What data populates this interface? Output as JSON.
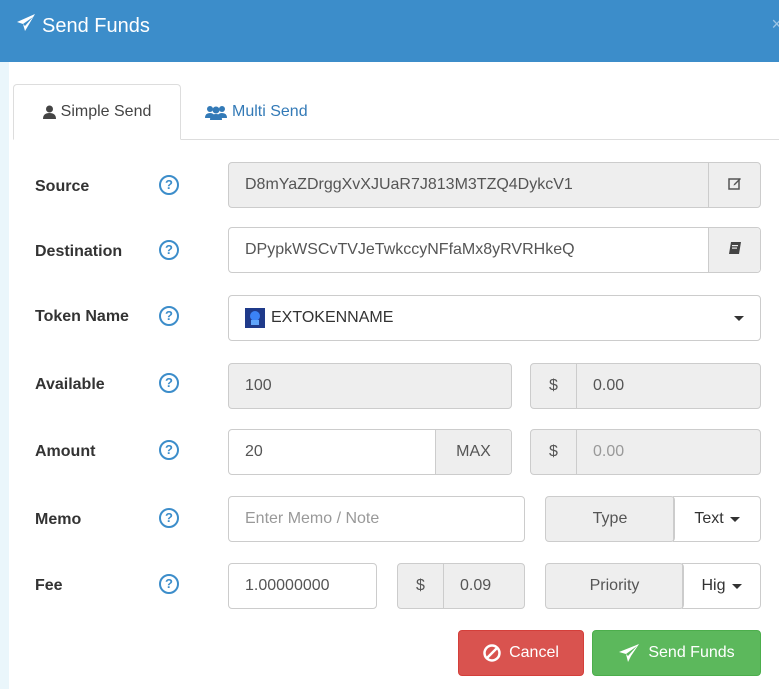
{
  "header": {
    "title": "Send Funds",
    "close": "×"
  },
  "tabs": [
    {
      "label": "Simple Send",
      "active": true
    },
    {
      "label": "Multi Send",
      "active": false
    }
  ],
  "form": {
    "source": {
      "label": "Source",
      "value": "D8mYaZDrggXvXJUaR7J813M3TZQ4DykcV1"
    },
    "destination": {
      "label": "Destination",
      "value": "DPypkWSCvTVJeTwkccyNFfaMx8yRVRHkeQ"
    },
    "token": {
      "label": "Token Name",
      "value": "EXTOKENNAME"
    },
    "available": {
      "label": "Available",
      "value": "100",
      "currency": "$",
      "usd": "0.00"
    },
    "amount": {
      "label": "Amount",
      "value": "20",
      "max": "MAX",
      "currency": "$",
      "usd": "0.00"
    },
    "memo": {
      "label": "Memo",
      "placeholder": "Enter Memo / Note",
      "type_label": "Type",
      "type_value": "Text"
    },
    "fee": {
      "label": "Fee",
      "value": "1.00000000",
      "currency": "$",
      "usd": "0.09",
      "priority_label": "Priority",
      "priority_value": "Hig"
    },
    "help": "?"
  },
  "buttons": {
    "cancel": "Cancel",
    "send": "Send Funds"
  },
  "colors": {
    "header": "#3c8dca",
    "danger": "#d9534f",
    "success": "#5cb85c",
    "link": "#337ab7"
  }
}
